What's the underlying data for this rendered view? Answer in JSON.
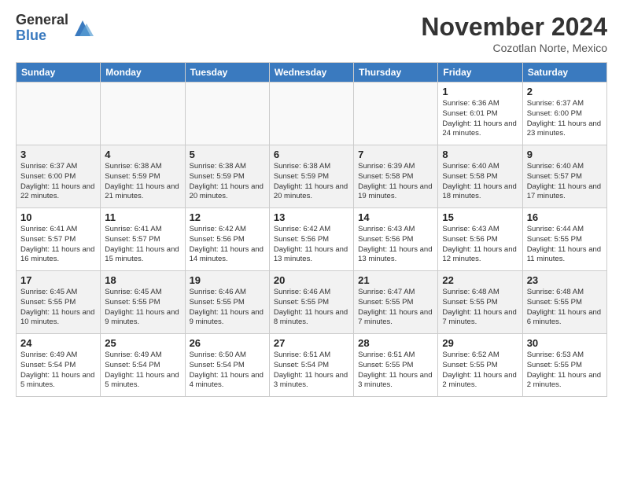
{
  "header": {
    "logo_general": "General",
    "logo_blue": "Blue",
    "month_title": "November 2024",
    "location": "Cozotlan Norte, Mexico"
  },
  "days_of_week": [
    "Sunday",
    "Monday",
    "Tuesday",
    "Wednesday",
    "Thursday",
    "Friday",
    "Saturday"
  ],
  "weeks": [
    [
      {
        "day": "",
        "info": ""
      },
      {
        "day": "",
        "info": ""
      },
      {
        "day": "",
        "info": ""
      },
      {
        "day": "",
        "info": ""
      },
      {
        "day": "",
        "info": ""
      },
      {
        "day": "1",
        "info": "Sunrise: 6:36 AM\nSunset: 6:01 PM\nDaylight: 11 hours and 24 minutes."
      },
      {
        "day": "2",
        "info": "Sunrise: 6:37 AM\nSunset: 6:00 PM\nDaylight: 11 hours and 23 minutes."
      }
    ],
    [
      {
        "day": "3",
        "info": "Sunrise: 6:37 AM\nSunset: 6:00 PM\nDaylight: 11 hours and 22 minutes."
      },
      {
        "day": "4",
        "info": "Sunrise: 6:38 AM\nSunset: 5:59 PM\nDaylight: 11 hours and 21 minutes."
      },
      {
        "day": "5",
        "info": "Sunrise: 6:38 AM\nSunset: 5:59 PM\nDaylight: 11 hours and 20 minutes."
      },
      {
        "day": "6",
        "info": "Sunrise: 6:38 AM\nSunset: 5:59 PM\nDaylight: 11 hours and 20 minutes."
      },
      {
        "day": "7",
        "info": "Sunrise: 6:39 AM\nSunset: 5:58 PM\nDaylight: 11 hours and 19 minutes."
      },
      {
        "day": "8",
        "info": "Sunrise: 6:40 AM\nSunset: 5:58 PM\nDaylight: 11 hours and 18 minutes."
      },
      {
        "day": "9",
        "info": "Sunrise: 6:40 AM\nSunset: 5:57 PM\nDaylight: 11 hours and 17 minutes."
      }
    ],
    [
      {
        "day": "10",
        "info": "Sunrise: 6:41 AM\nSunset: 5:57 PM\nDaylight: 11 hours and 16 minutes."
      },
      {
        "day": "11",
        "info": "Sunrise: 6:41 AM\nSunset: 5:57 PM\nDaylight: 11 hours and 15 minutes."
      },
      {
        "day": "12",
        "info": "Sunrise: 6:42 AM\nSunset: 5:56 PM\nDaylight: 11 hours and 14 minutes."
      },
      {
        "day": "13",
        "info": "Sunrise: 6:42 AM\nSunset: 5:56 PM\nDaylight: 11 hours and 13 minutes."
      },
      {
        "day": "14",
        "info": "Sunrise: 6:43 AM\nSunset: 5:56 PM\nDaylight: 11 hours and 13 minutes."
      },
      {
        "day": "15",
        "info": "Sunrise: 6:43 AM\nSunset: 5:56 PM\nDaylight: 11 hours and 12 minutes."
      },
      {
        "day": "16",
        "info": "Sunrise: 6:44 AM\nSunset: 5:55 PM\nDaylight: 11 hours and 11 minutes."
      }
    ],
    [
      {
        "day": "17",
        "info": "Sunrise: 6:45 AM\nSunset: 5:55 PM\nDaylight: 11 hours and 10 minutes."
      },
      {
        "day": "18",
        "info": "Sunrise: 6:45 AM\nSunset: 5:55 PM\nDaylight: 11 hours and 9 minutes."
      },
      {
        "day": "19",
        "info": "Sunrise: 6:46 AM\nSunset: 5:55 PM\nDaylight: 11 hours and 9 minutes."
      },
      {
        "day": "20",
        "info": "Sunrise: 6:46 AM\nSunset: 5:55 PM\nDaylight: 11 hours and 8 minutes."
      },
      {
        "day": "21",
        "info": "Sunrise: 6:47 AM\nSunset: 5:55 PM\nDaylight: 11 hours and 7 minutes."
      },
      {
        "day": "22",
        "info": "Sunrise: 6:48 AM\nSunset: 5:55 PM\nDaylight: 11 hours and 7 minutes."
      },
      {
        "day": "23",
        "info": "Sunrise: 6:48 AM\nSunset: 5:55 PM\nDaylight: 11 hours and 6 minutes."
      }
    ],
    [
      {
        "day": "24",
        "info": "Sunrise: 6:49 AM\nSunset: 5:54 PM\nDaylight: 11 hours and 5 minutes."
      },
      {
        "day": "25",
        "info": "Sunrise: 6:49 AM\nSunset: 5:54 PM\nDaylight: 11 hours and 5 minutes."
      },
      {
        "day": "26",
        "info": "Sunrise: 6:50 AM\nSunset: 5:54 PM\nDaylight: 11 hours and 4 minutes."
      },
      {
        "day": "27",
        "info": "Sunrise: 6:51 AM\nSunset: 5:54 PM\nDaylight: 11 hours and 3 minutes."
      },
      {
        "day": "28",
        "info": "Sunrise: 6:51 AM\nSunset: 5:55 PM\nDaylight: 11 hours and 3 minutes."
      },
      {
        "day": "29",
        "info": "Sunrise: 6:52 AM\nSunset: 5:55 PM\nDaylight: 11 hours and 2 minutes."
      },
      {
        "day": "30",
        "info": "Sunrise: 6:53 AM\nSunset: 5:55 PM\nDaylight: 11 hours and 2 minutes."
      }
    ]
  ]
}
